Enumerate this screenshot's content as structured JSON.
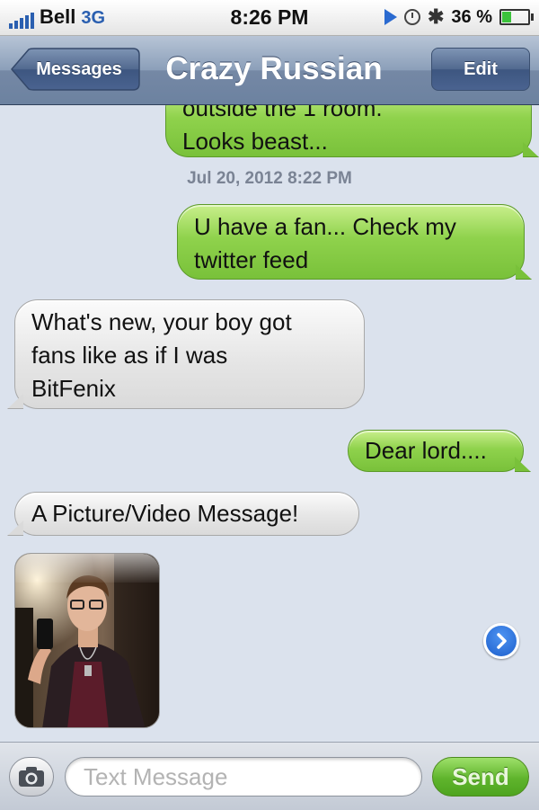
{
  "status_bar": {
    "carrier": "Bell",
    "network": "3G",
    "time": "8:26 PM",
    "battery": "36 %",
    "battery_level": 0.36,
    "icons": [
      "signal-bars-icon",
      "play-icon",
      "lock-rotation-icon",
      "bluetooth-icon",
      "battery-icon"
    ]
  },
  "nav": {
    "back_label": "Messages",
    "title": "Crazy Russian",
    "edit_label": "Edit"
  },
  "messages": [
    {
      "direction": "out",
      "lines": [
        "outside the 1 room.",
        "Looks beast..."
      ]
    },
    {
      "timestamp": "Jul 20, 2012 8:22 PM"
    },
    {
      "direction": "out",
      "lines": [
        "U have a fan... Check my",
        "twitter feed"
      ]
    },
    {
      "direction": "in",
      "lines": [
        "What's new, your boy got",
        "fans like as if I was",
        "BitFenix"
      ]
    },
    {
      "direction": "out",
      "lines": [
        "Dear lord...."
      ]
    },
    {
      "direction": "in",
      "lines": [
        "A Picture/Video Message!"
      ]
    },
    {
      "direction": "in",
      "type": "photo",
      "icon": "mms-photo-thumbnail"
    }
  ],
  "input": {
    "placeholder": "Text Message",
    "send_label": "Send",
    "camera_icon": "camera-icon",
    "detail_icon": "chevron-right-circle-icon"
  },
  "colors": {
    "outgoing_bubble": "#8fd24c",
    "incoming_bubble": "#e6e6e6",
    "background": "#dbe2ed",
    "nav_bar": "#8b9fb9",
    "send_button": "#5fb42c"
  }
}
